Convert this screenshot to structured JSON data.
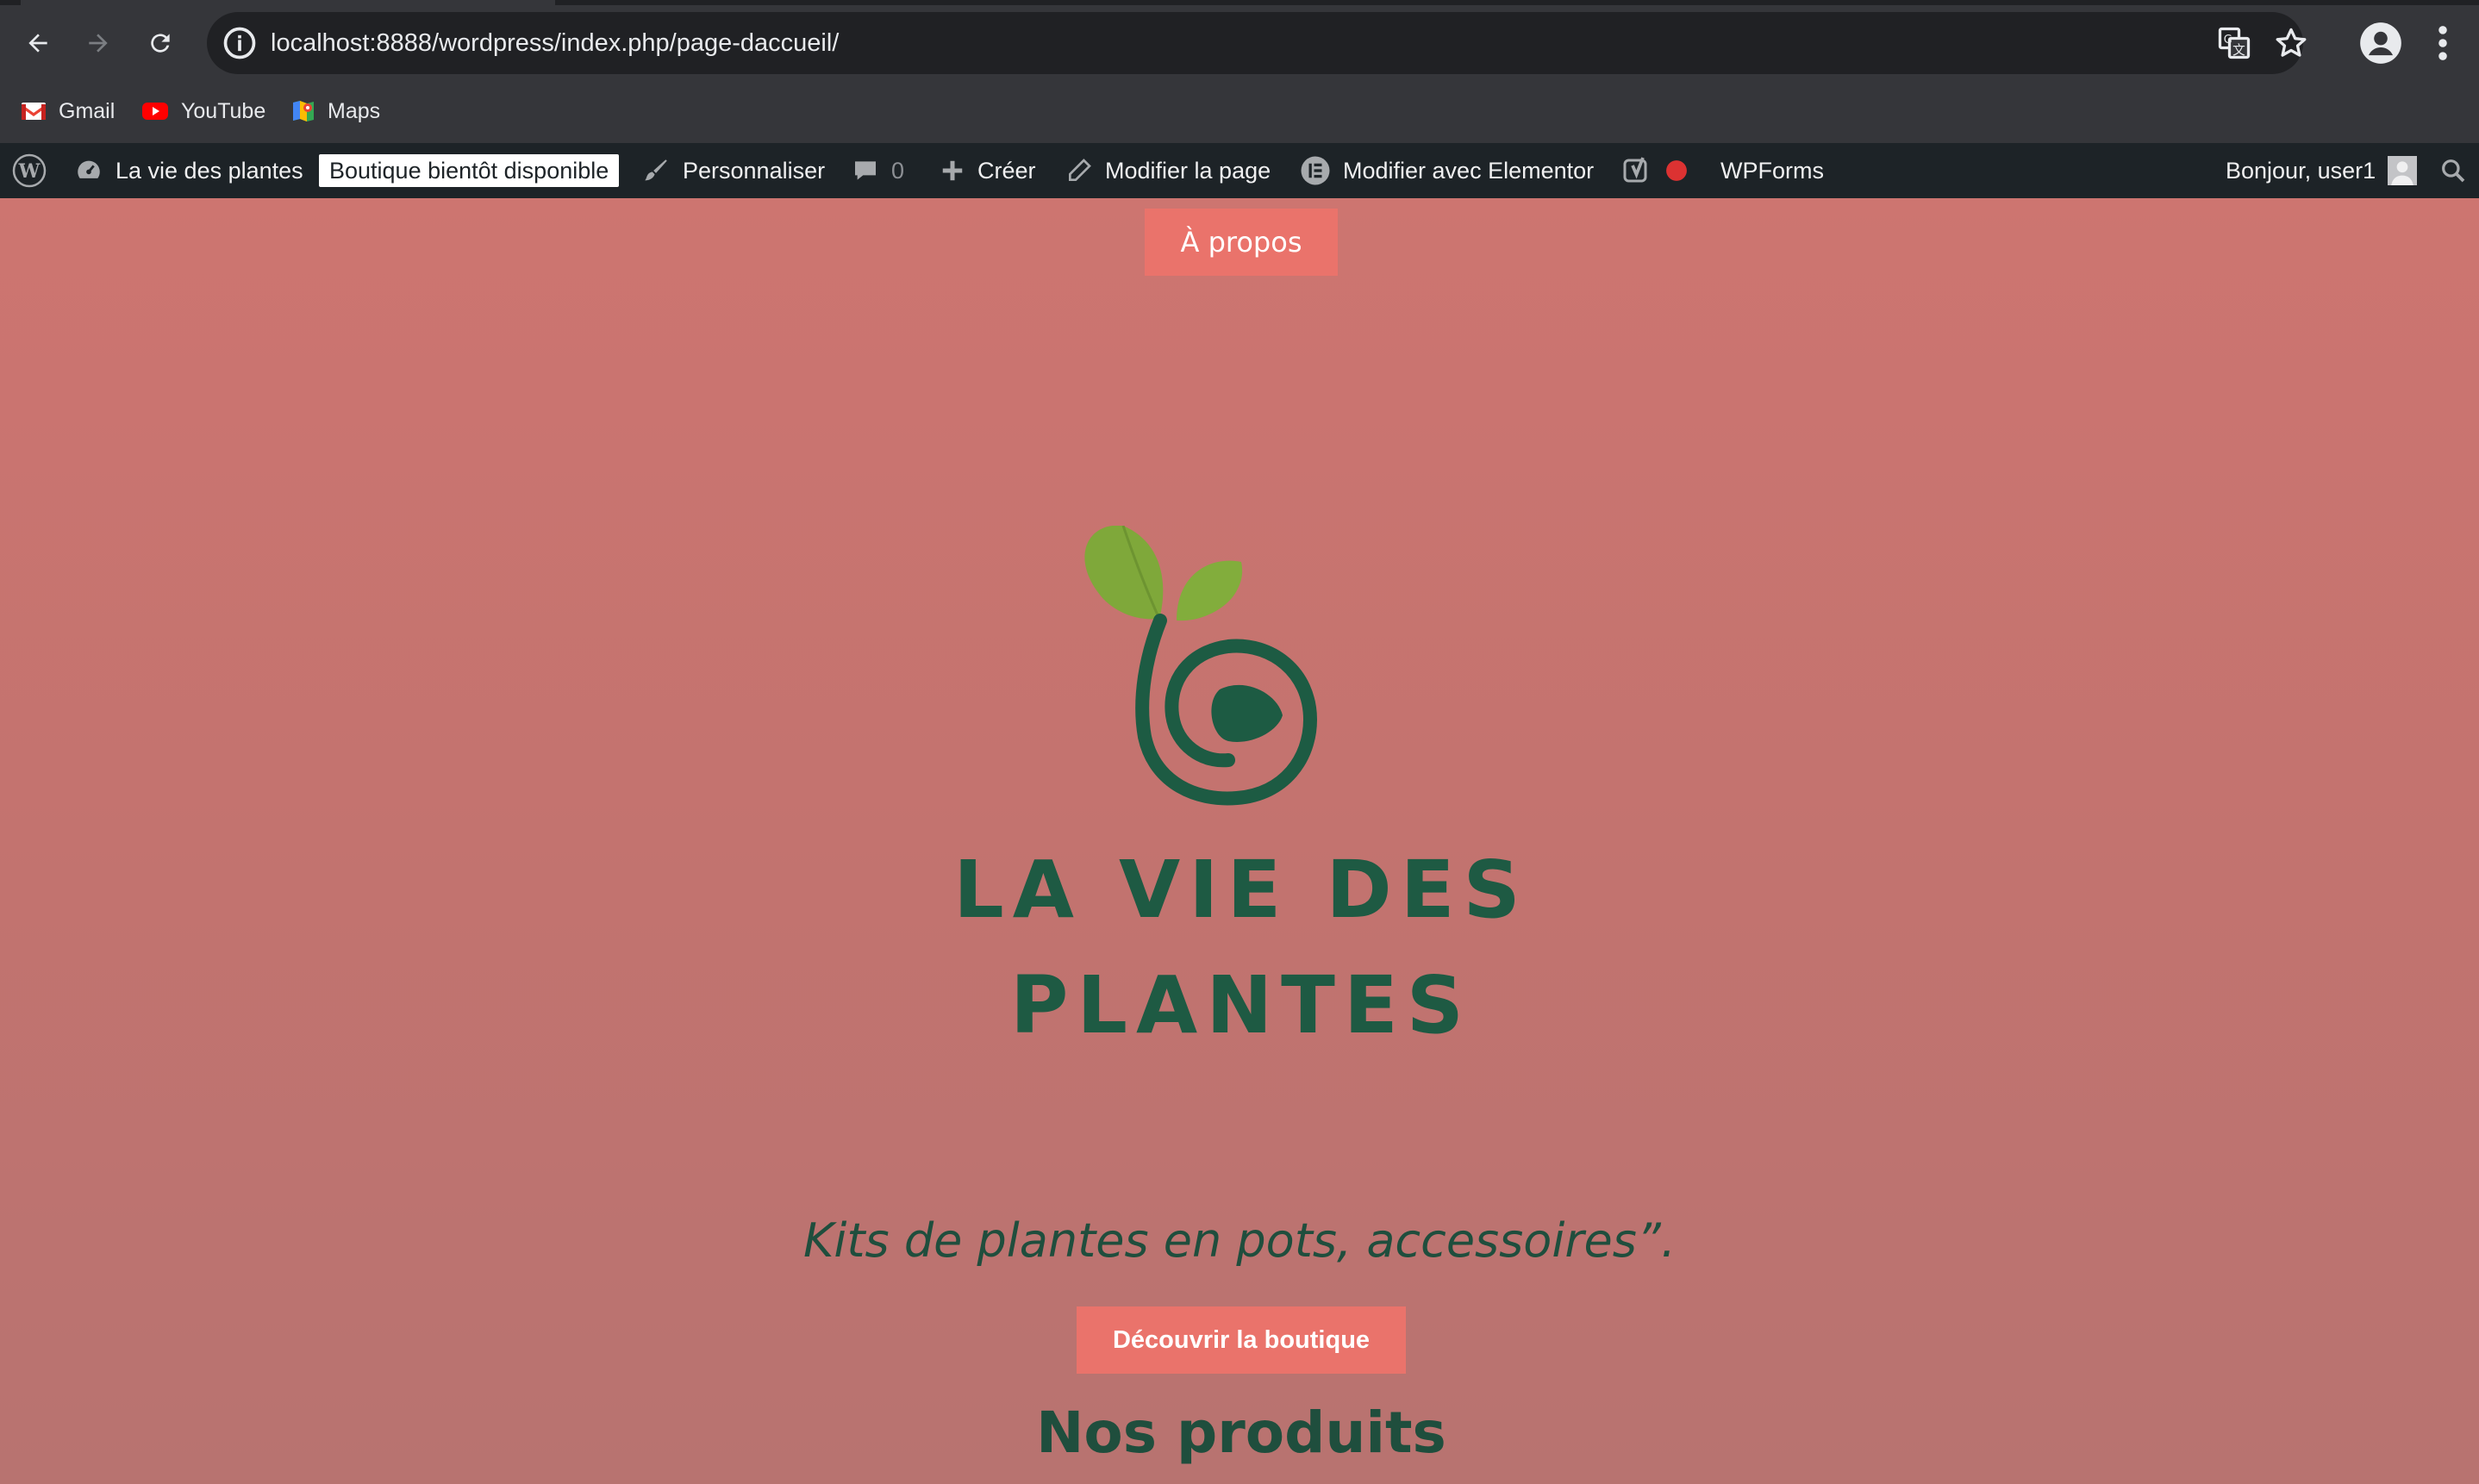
{
  "browser": {
    "url": "localhost:8888/wordpress/index.php/page-daccueil/",
    "bookmarks": [
      {
        "label": "Gmail",
        "icon": "gmail-icon"
      },
      {
        "label": "YouTube",
        "icon": "youtube-icon"
      },
      {
        "label": "Maps",
        "icon": "maps-icon"
      }
    ]
  },
  "admin_bar": {
    "site_name": "La vie des plantes",
    "status_badge": "Boutique bientôt disponible",
    "customize": "Personnaliser",
    "comments_count": "0",
    "new": "Créer",
    "edit_page": "Modifier la page",
    "edit_elementor": "Modifier avec Elementor",
    "wpforms": "WPForms",
    "greeting": "Bonjour, user1"
  },
  "page": {
    "nav_button": "À propos",
    "brand_line1": "LA VIE DES",
    "brand_line2": "PLANTES",
    "tagline": "Kits de plantes en pots, accessoires”.",
    "cta_button": "Découvrir la boutique",
    "section_title": "Nos produits"
  },
  "colors": {
    "background_top": "#cd7570",
    "background_bottom": "#b87370",
    "accent_button": "#ea736b",
    "brand_green": "#1e5a43",
    "leaf_green": "#7fa83a",
    "admin_bar": "#1d2327"
  }
}
